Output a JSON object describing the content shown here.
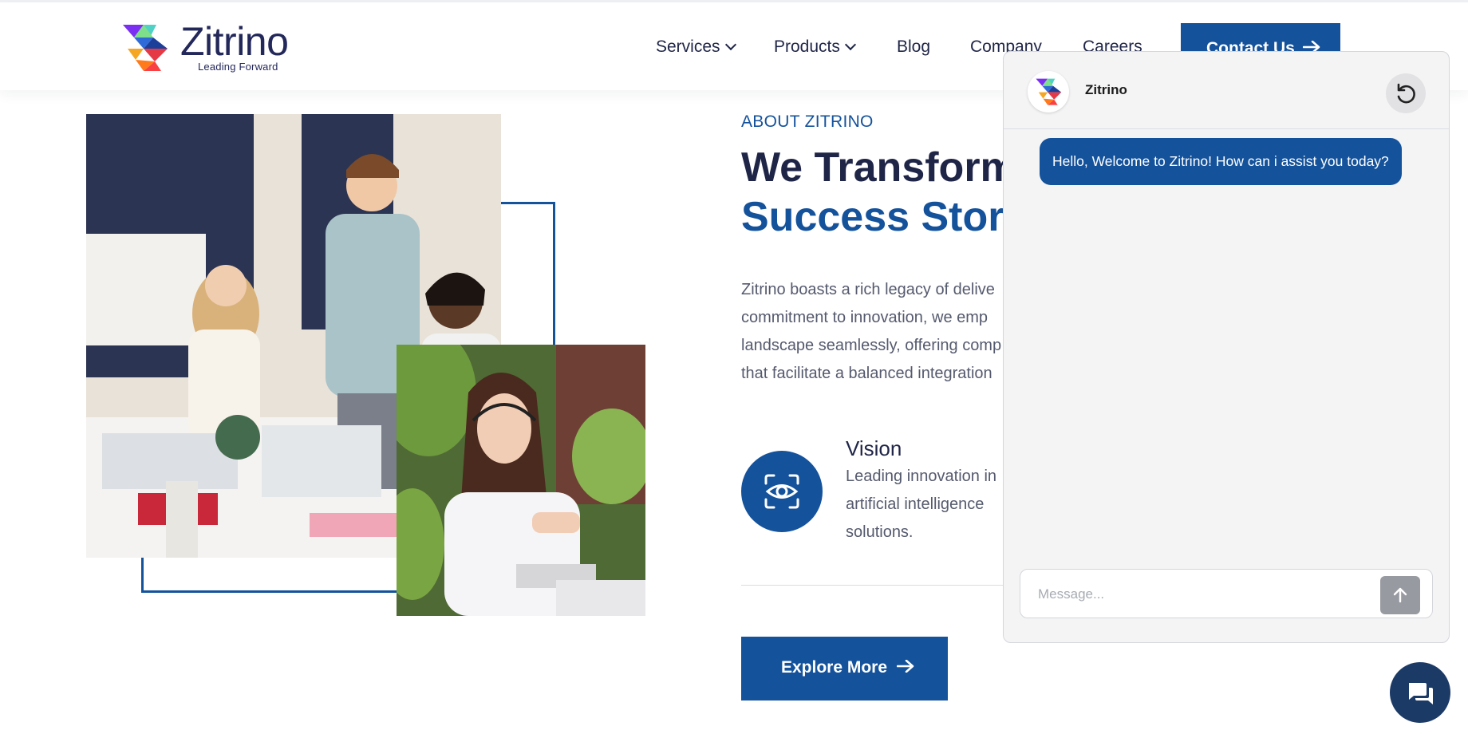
{
  "brand": {
    "name": "Zitrino",
    "tagline": "Leading Forward",
    "icon": "zitrino-logo-icon"
  },
  "nav": {
    "items": [
      {
        "label": "Services",
        "has_dropdown": true
      },
      {
        "label": "Products",
        "has_dropdown": true
      },
      {
        "label": "Blog",
        "has_dropdown": false
      },
      {
        "label": "Company",
        "has_dropdown": false
      },
      {
        "label": "Careers",
        "has_dropdown": false
      }
    ],
    "contact_label": "Contact Us",
    "contact_icon": "arrow-right-icon"
  },
  "about": {
    "eyebrow": "ABOUT ZITRINO",
    "heading_line1": "We Transform",
    "heading_line2": "Success Storie",
    "paragraph_lines": [
      "Zitrino boasts a rich legacy of delive",
      "commitment to innovation, we emp",
      "landscape seamlessly, offering comp",
      "that facilitate a balanced integration"
    ],
    "vision": {
      "icon": "eye-scan-icon",
      "title": "Vision",
      "lines": [
        "Leading innovation in",
        "artificial intelligence",
        "solutions."
      ]
    },
    "cta_label": "Explore More",
    "cta_icon": "arrow-right-icon"
  },
  "chat": {
    "bot_name": "Zitrino",
    "reset_icon": "refresh-icon",
    "welcome_message": "Hello, Welcome to Zitrino! How can i assist you today?",
    "input_placeholder": "Message...",
    "send_icon": "arrow-up-icon",
    "launcher_icon": "chat-bubbles-icon"
  },
  "colors": {
    "primary": "#14529b",
    "navy_text": "#1f2547",
    "launcher": "#1b3a66",
    "send_disabled": "#979aa1"
  }
}
